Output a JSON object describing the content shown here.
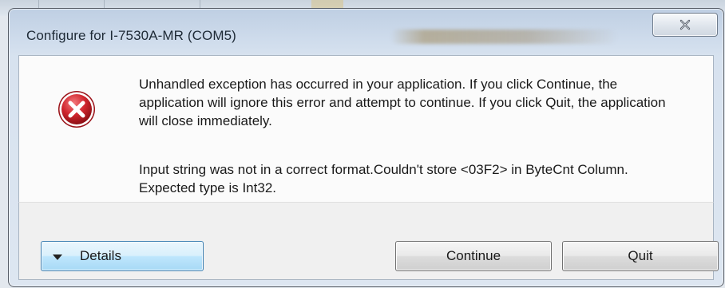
{
  "window": {
    "title": "Configure for I-7530A-MR (COM5)"
  },
  "dialog": {
    "icon": "error-x-icon",
    "message": "Unhandled exception has occurred in your application. If you click Continue, the application will ignore this error and attempt to continue. If you click Quit, the application will close immediately.",
    "detail": "Input string was not in a correct format.Couldn't store <03F2> in ByteCnt Column.  Expected type is Int32."
  },
  "buttons": {
    "details_label": "Details",
    "continue_label": "Continue",
    "quit_label": "Quit"
  },
  "colors": {
    "error_red": "#c8232c",
    "details_accent": "#3c7fb1"
  }
}
